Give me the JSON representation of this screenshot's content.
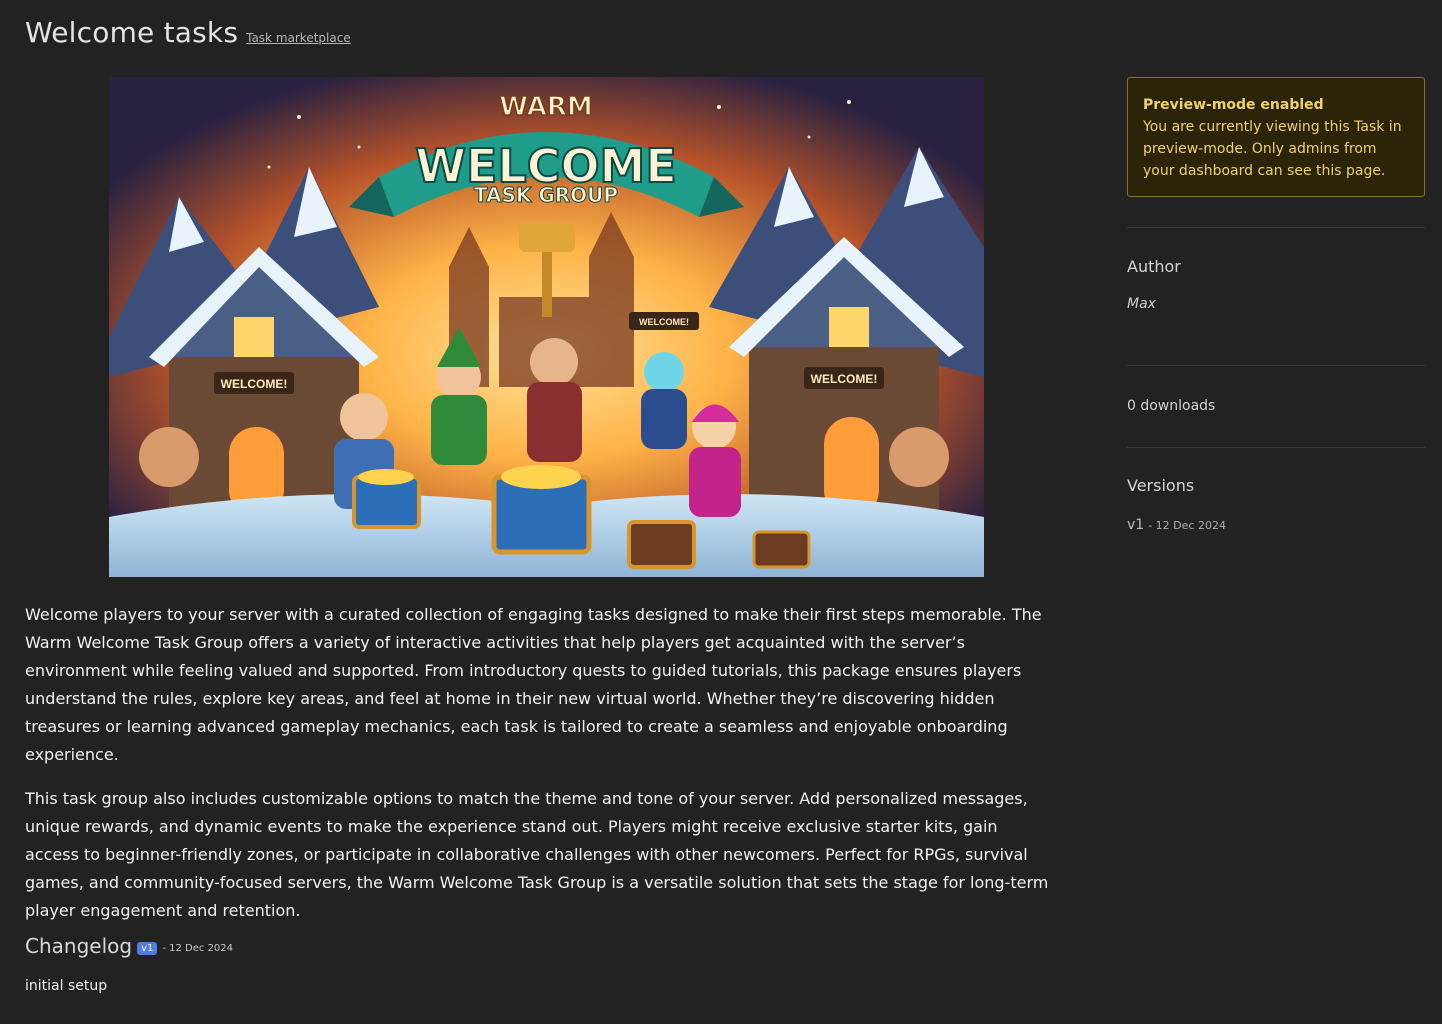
{
  "header": {
    "title": "Welcome tasks",
    "marketplace_link": "Task marketplace"
  },
  "hero": {
    "banner_top": "WARM",
    "banner_main": "WELCOME",
    "banner_sub": "TASK GROUP",
    "sign_left": "WELCOME!",
    "sign_right": "WELCOME!",
    "sign_center": "WELCOME!",
    "colors": {
      "sky": "#2a2140",
      "glow": "#ffb347",
      "banner": "#1f9c8a",
      "banner_dark": "#14665c",
      "text": "#fff3d6"
    }
  },
  "description": {
    "paragraphs": [
      "Welcome players to your server with a curated collection of engaging tasks designed to make their first steps memorable. The Warm Welcome Task Group offers a variety of interactive activities that help players get acquainted with the server’s environment while feeling valued and supported. From introductory quests to guided tutorials, this package ensures players understand the rules, explore key areas, and feel at home in their new virtual world. Whether they’re discovering hidden treasures or learning advanced gameplay mechanics, each task is tailored to create a seamless and enjoyable onboarding experience.",
      "This task group also includes customizable options to match the theme and tone of your server. Add personalized messages, unique rewards, and dynamic events to make the experience stand out. Players might receive exclusive starter kits, gain access to beginner-friendly zones, or participate in collaborative challenges with other newcomers. Perfect for RPGs, survival games, and community-focused servers, the Warm Welcome Task Group is a versatile solution that sets the stage for long-term player engagement and retention."
    ]
  },
  "changelog": {
    "title": "Changelog",
    "badge": "v1",
    "date": "- 12 Dec 2024",
    "body": "initial setup"
  },
  "sidebar": {
    "alert": {
      "title": "Preview-mode enabled",
      "message": "You are currently viewing this Task in preview-mode. Only admins from your dashboard can see this page.",
      "color": "#f2d16b"
    },
    "author_title": "Author",
    "author_name": "Max",
    "downloads": "0 downloads",
    "versions_title": "Versions",
    "versions": [
      {
        "label": "v1",
        "date": "- 12 Dec 2024"
      }
    ]
  }
}
